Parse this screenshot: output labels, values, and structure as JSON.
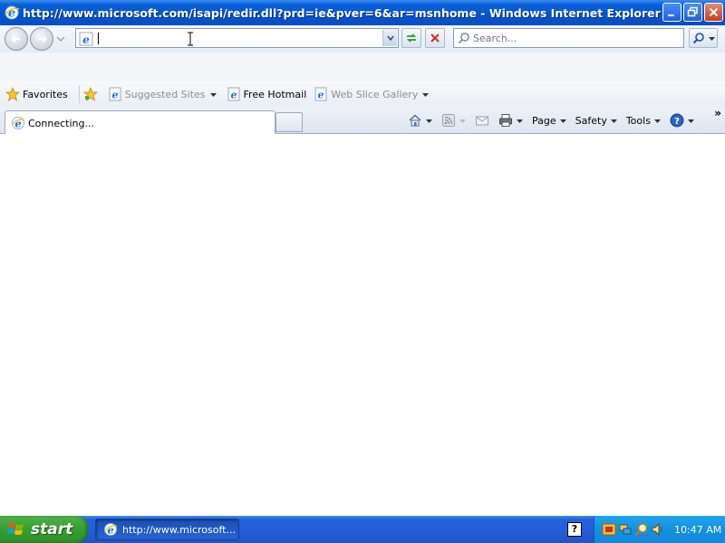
{
  "window": {
    "title": "http://www.microsoft.com/isapi/redir.dll?prd=ie&pver=6&ar=msnhome - Windows Internet Explorer"
  },
  "address_bar": {
    "value": ""
  },
  "search": {
    "placeholder": "Search..."
  },
  "favorites_bar": {
    "favorites_label": "Favorites",
    "items": [
      {
        "label": "Suggested Sites",
        "enabled": false,
        "has_dropdown": true
      },
      {
        "label": "Free Hotmail",
        "enabled": true,
        "has_dropdown": false
      },
      {
        "label": "Web Slice Gallery",
        "enabled": false,
        "has_dropdown": true
      }
    ]
  },
  "tabs": [
    {
      "label": "Connecting...",
      "active": true
    }
  ],
  "command_bar": {
    "page_label": "Page",
    "safety_label": "Safety",
    "tools_label": "Tools"
  },
  "taskbar": {
    "start_label": "start",
    "task_label": "http://www.microsoft...",
    "clock": "10:47 AM"
  },
  "icons": [
    "ie-icon",
    "minimize-icon",
    "maximize-icon",
    "close-icon",
    "back-icon",
    "forward-icon",
    "refresh-icon",
    "stop-icon",
    "search-icon",
    "home-icon",
    "feeds-icon",
    "read-mail-icon",
    "print-icon",
    "help-icon",
    "star-icon",
    "add-favorites-icon",
    "windows-logo-icon"
  ],
  "colors": {
    "titlebar": "#0553cf",
    "taskbar": "#245edb",
    "start_button": "#37a033",
    "tray": "#1590e0"
  }
}
